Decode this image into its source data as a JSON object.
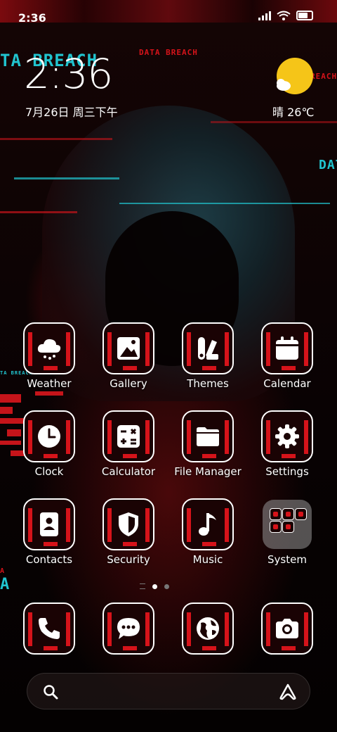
{
  "status_bar": {
    "time": "2:36"
  },
  "lock_widget": {
    "time": "2:36",
    "date": "7月26日 周三下午",
    "weather": "晴 26℃"
  },
  "wallpaper_text": {
    "top_left": "TA BREACH",
    "top_center": "DATA BREACH",
    "top_right": "REACH",
    "right_mid": "DAT",
    "left_small": "TA BREACH",
    "left_bottom_top": "A",
    "left_bottom": "A"
  },
  "apps": [
    {
      "label": "Weather",
      "icon": "cloud-icon"
    },
    {
      "label": "Gallery",
      "icon": "image-icon"
    },
    {
      "label": "Themes",
      "icon": "brush-palette-icon"
    },
    {
      "label": "Calendar",
      "icon": "calendar-icon"
    },
    {
      "label": "Clock",
      "icon": "clock-icon"
    },
    {
      "label": "Calculator",
      "icon": "calculator-icon"
    },
    {
      "label": "File Manager",
      "icon": "folder-icon"
    },
    {
      "label": "Settings",
      "icon": "gear-icon"
    },
    {
      "label": "Contacts",
      "icon": "contact-book-icon"
    },
    {
      "label": "Security",
      "icon": "shield-icon"
    },
    {
      "label": "Music",
      "icon": "music-note-icon"
    },
    {
      "label": "System",
      "icon": "folder-group-icon"
    }
  ],
  "dock": [
    {
      "icon": "phone-icon"
    },
    {
      "icon": "message-icon"
    },
    {
      "icon": "globe-icon"
    },
    {
      "icon": "camera-icon"
    }
  ],
  "page_indicator": {
    "pages": 2,
    "current": 1
  },
  "search_bar": {
    "left_icon": "search-icon",
    "right_icon": "assistant-icon"
  },
  "colors": {
    "accent_red": "#d6131a",
    "accent_cyan": "#21c4cf",
    "sun_yellow": "#f5c518"
  }
}
